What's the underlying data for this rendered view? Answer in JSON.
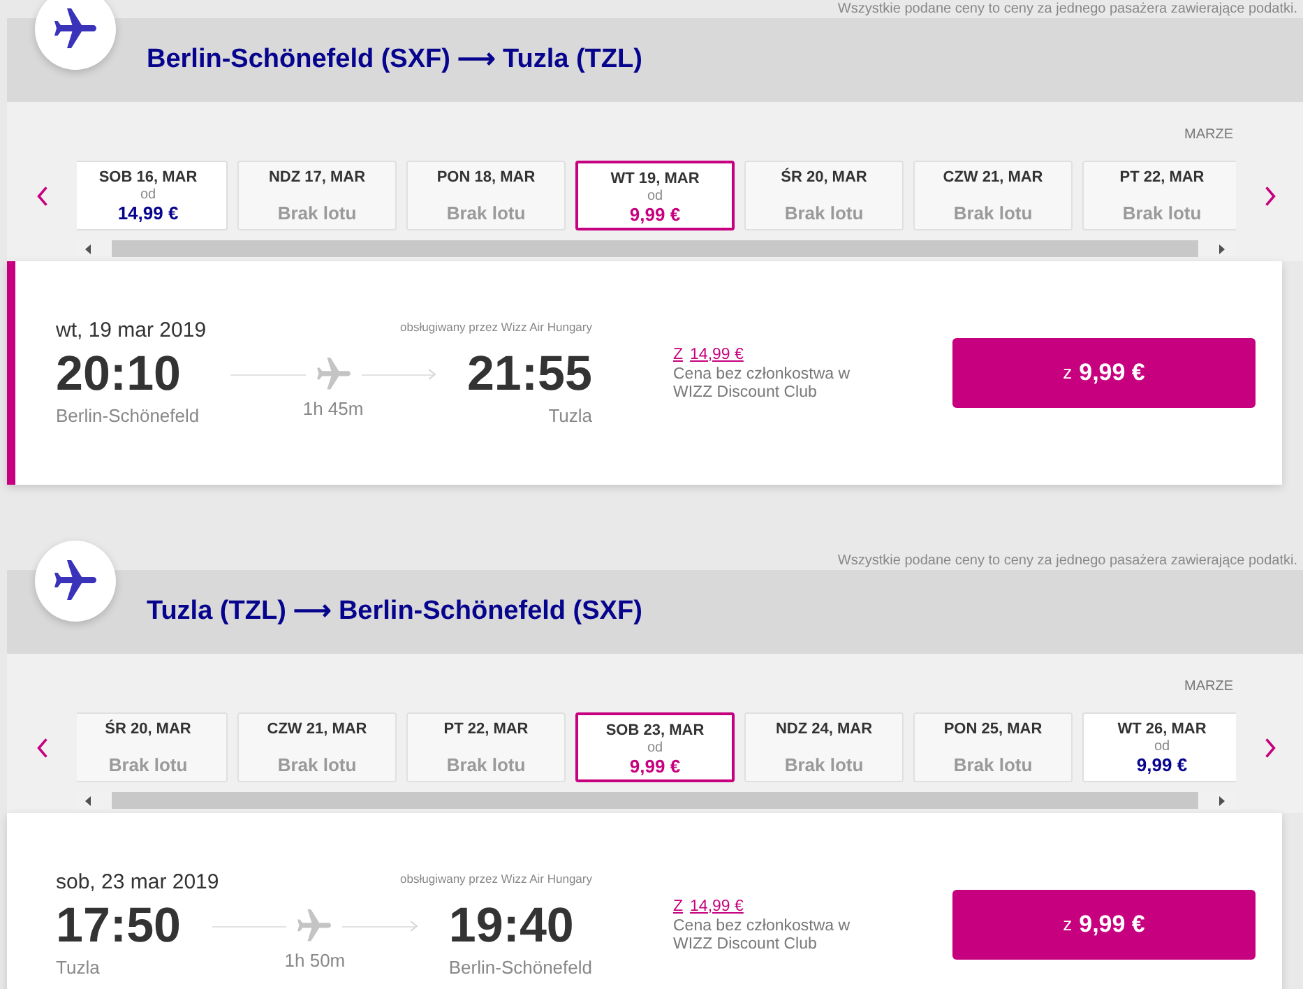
{
  "sections": [
    {
      "notice": "Wszystkie podane ceny to ceny za jednego pasażera zawierające podatki.",
      "title": "Berlin-Schönefeld (SXF) ⟶ Tuzla (TZL)",
      "month": "MARZE",
      "dates": [
        {
          "kind": "fare",
          "day": "SOB 16, MAR",
          "from": "od",
          "price": "14,99 €",
          "selected": false
        },
        {
          "kind": "none",
          "day": "NDZ 17, MAR",
          "text": "Brak lotu",
          "selected": false
        },
        {
          "kind": "none",
          "day": "PON 18, MAR",
          "text": "Brak lotu",
          "selected": false
        },
        {
          "kind": "fare",
          "day": "WT 19, MAR",
          "from": "od",
          "price": "9,99 €",
          "selected": true
        },
        {
          "kind": "none",
          "day": "ŚR 20, MAR",
          "text": "Brak lotu",
          "selected": false
        },
        {
          "kind": "none",
          "day": "CZW 21, MAR",
          "text": "Brak lotu",
          "selected": false
        },
        {
          "kind": "none",
          "day": "PT 22, MAR",
          "text": "Brak lotu",
          "selected": false
        }
      ],
      "flight": {
        "selected": true,
        "date": "wt, 19 mar 2019",
        "operator": "obsługiwany przez Wizz Air Hungary",
        "departure_time": "20:10",
        "departure_city": "Berlin-Schönefeld",
        "duration": "1h 45m",
        "arrival_time": "21:55",
        "arrival_city": "Tuzla",
        "member_price": {
          "prefix": "Z",
          "amount": "14,99 €"
        },
        "member_note": "Cena bez członkostwa w WIZZ Discount Club",
        "button": {
          "prefix": "z",
          "amount": "9,99 €"
        }
      }
    },
    {
      "notice": "Wszystkie podane ceny to ceny za jednego pasażera zawierające podatki.",
      "title": "Tuzla (TZL) ⟶ Berlin-Schönefeld (SXF)",
      "month": "MARZE",
      "dates": [
        {
          "kind": "none",
          "day": "ŚR 20, MAR",
          "text": "Brak lotu",
          "selected": false
        },
        {
          "kind": "none",
          "day": "CZW 21, MAR",
          "text": "Brak lotu",
          "selected": false
        },
        {
          "kind": "none",
          "day": "PT 22, MAR",
          "text": "Brak lotu",
          "selected": false
        },
        {
          "kind": "fare",
          "day": "SOB 23, MAR",
          "from": "od",
          "price": "9,99 €",
          "selected": true
        },
        {
          "kind": "none",
          "day": "NDZ 24, MAR",
          "text": "Brak lotu",
          "selected": false
        },
        {
          "kind": "none",
          "day": "PON 25, MAR",
          "text": "Brak lotu",
          "selected": false
        },
        {
          "kind": "fare",
          "day": "WT 26, MAR",
          "from": "od",
          "price": "9,99 €",
          "selected": false
        }
      ],
      "flight": {
        "selected": false,
        "date": "sob, 23 mar 2019",
        "operator": "obsługiwany przez Wizz Air Hungary",
        "departure_time": "17:50",
        "departure_city": "Tuzla",
        "duration": "1h 50m",
        "arrival_time": "19:40",
        "arrival_city": "Berlin-Schönefeld",
        "member_price": {
          "prefix": "Z",
          "amount": "14,99 €"
        },
        "member_note": "Cena bez członkostwa w WIZZ Discount Club",
        "button": {
          "prefix": "z",
          "amount": "9,99 €"
        }
      }
    }
  ]
}
